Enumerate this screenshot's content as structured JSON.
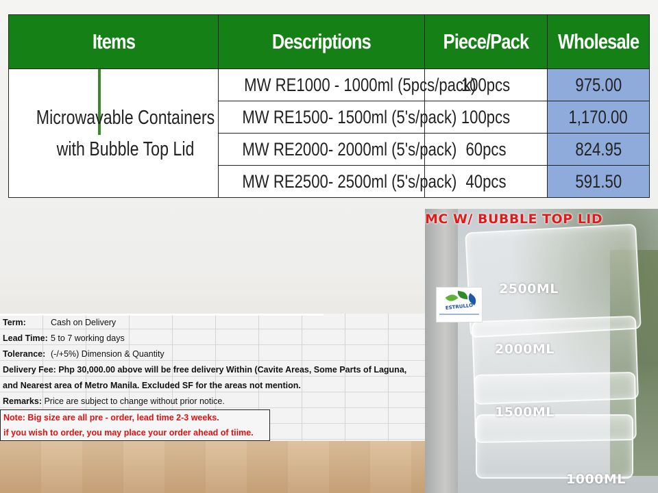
{
  "table": {
    "headers": [
      "Items",
      "Descriptions",
      "Piece/Pack",
      "Wholesale"
    ],
    "item": "Microwavable Containers with Bubble Top Lid",
    "rows": [
      {
        "description": "MW RE1000 - 1000ml (5pcs/pack)",
        "piece_pack": "100pcs",
        "wholesale": "975.00"
      },
      {
        "description": "MW RE1500- 1500ml (5's/pack)",
        "piece_pack": "100pcs",
        "wholesale": "1,170.00"
      },
      {
        "description": "MW RE2000- 2000ml (5's/pack)",
        "piece_pack": "60pcs",
        "wholesale": "824.95"
      },
      {
        "description": "MW RE2500- 2500ml (5's/pack)",
        "piece_pack": "40pcs",
        "wholesale": "591.50"
      }
    ],
    "colors": {
      "header_bg": "#158016",
      "wholesale_bg": "#8eabdb"
    }
  },
  "terms": {
    "term_label": "Term:",
    "term_value": "Cash on Delivery",
    "lead_label": "Lead Time:",
    "lead_value": "5 to 7 working days",
    "tolerance_label": "Tolerance:",
    "tolerance_value": "(-/+5%) Dimension & Quantity",
    "delivery_label": "Delivery Fee:",
    "delivery_line1": "Php 30,000.00 above will be free delivery Within (Cavite Areas, Some Parts of Laguna,",
    "delivery_line2": "and Nearest area of Metro Manila. Excluded SF for the areas not mention.",
    "remarks_label": "Remarks:",
    "remarks_value": "Price are subject to change without prior notice.",
    "note_line1": "Note: Big size are all pre - order, lead time 2-3 weeks.",
    "note_line2": "if you wish to order, you may place your order ahead of tiime."
  },
  "photo": {
    "banner": "MC W/ BUBBLE TOP LID",
    "logo_text": "ESTRULLO",
    "captions": [
      "2500ML",
      "2000ML",
      "1500ML",
      "1000ML"
    ]
  }
}
